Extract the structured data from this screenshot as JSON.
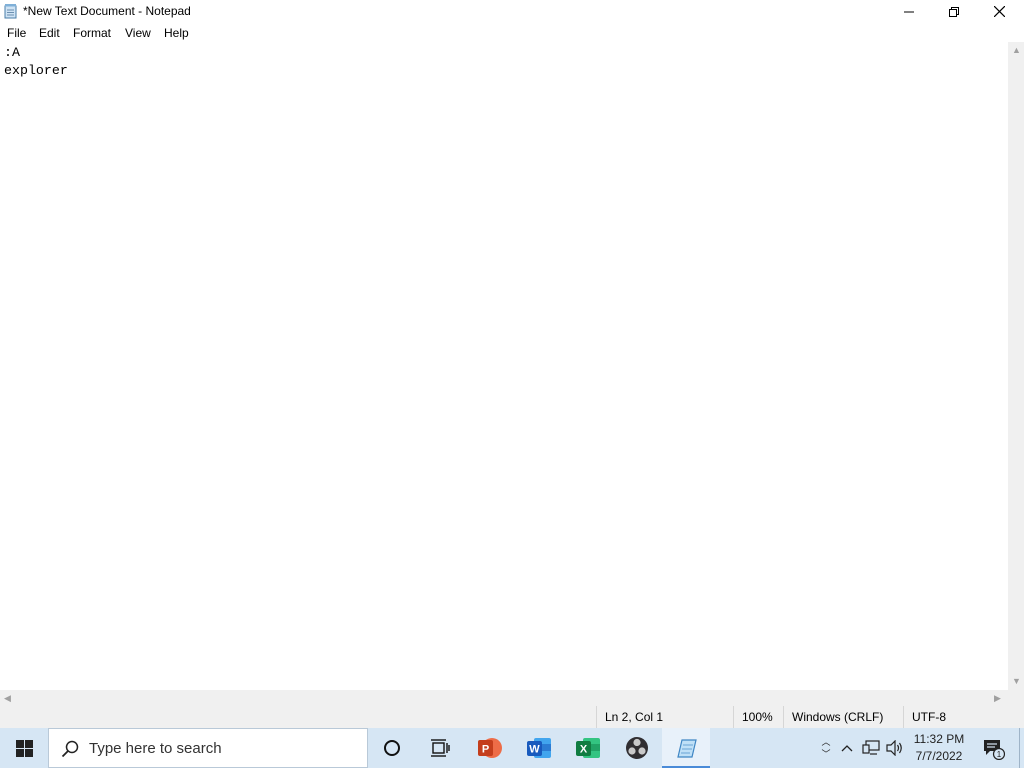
{
  "window": {
    "title": "*New Text Document - Notepad",
    "minimize_glyph": "─",
    "restore_glyph": "❐",
    "close_glyph": "✕"
  },
  "menu": {
    "items": [
      "File",
      "Edit",
      "Format",
      "View",
      "Help"
    ]
  },
  "editor": {
    "content": ":A\nexplorer"
  },
  "status": {
    "position": "Ln 2, Col 1",
    "zoom": "100%",
    "line_endings": "Windows (CRLF)",
    "encoding": "UTF-8"
  },
  "taskbar": {
    "search_placeholder": "Type here to search",
    "apps": [
      "cortana-icon",
      "task-view-icon",
      "powerpoint-icon",
      "word-icon",
      "excel-icon",
      "obs-icon",
      "notepad-icon"
    ],
    "time": "11:32 PM",
    "date": "7/7/2022",
    "notification_count": "1"
  },
  "colors": {
    "taskbar_bg": "#d6e6f4",
    "powerpoint": "#c43e1c",
    "word": "#185abd",
    "excel": "#107c41",
    "active_indicator": "#4a8bd8"
  }
}
